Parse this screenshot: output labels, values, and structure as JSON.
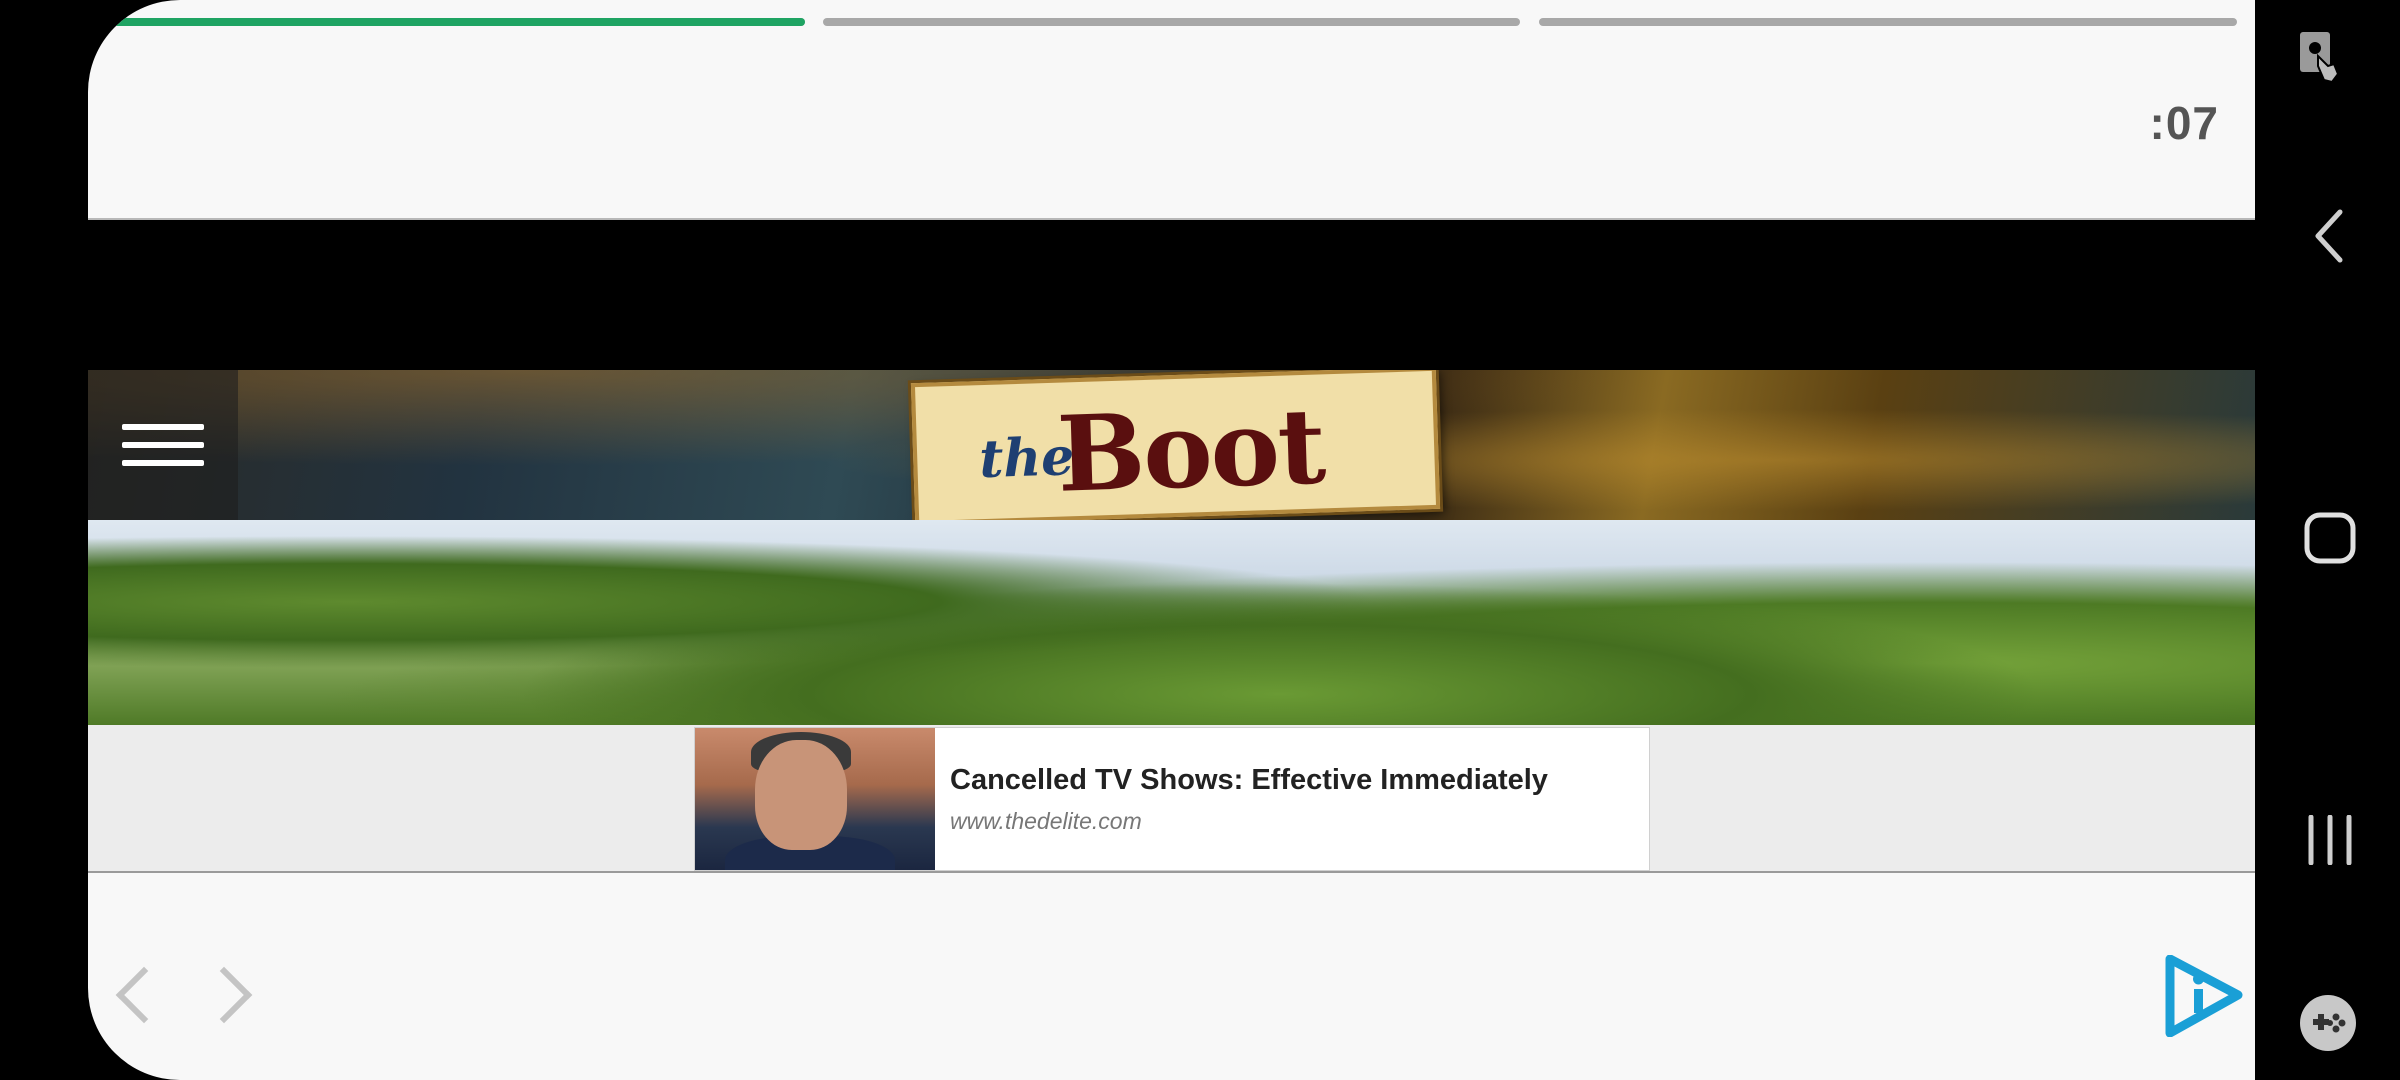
{
  "story": {
    "progress": [
      1.0,
      0.0,
      0.0
    ],
    "countdown": ":07",
    "colors": {
      "active": "#1fa463",
      "inactive": "#a8a8a8"
    }
  },
  "site": {
    "logo_the": "the",
    "logo_boot": "Boot",
    "menu_icon": "hamburger-menu-icon"
  },
  "ad": {
    "title": "Cancelled TV Shows: Effective Immediately",
    "url": "www.thedelite.com"
  },
  "bottom_nav": {
    "prev_icon": "chevron-left-icon",
    "next_icon": "chevron-right-icon",
    "brand_icon": "play-info-icon",
    "brand_color": "#1a9fd6"
  },
  "system_nav": {
    "items": [
      "screen-touch-icon",
      "back-icon",
      "home-icon",
      "recents-icon",
      "game-tools-icon"
    ]
  }
}
